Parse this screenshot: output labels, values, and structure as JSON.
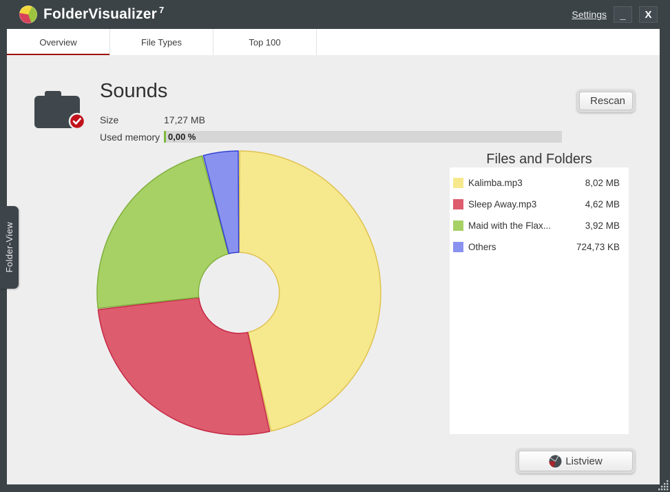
{
  "window": {
    "title": "FolderVisualizer",
    "version": "7",
    "settings_label": "Settings",
    "minimize_glyph": "_",
    "close_glyph": "X"
  },
  "tabs": [
    {
      "label": "Overview",
      "active": true
    },
    {
      "label": "File Types",
      "active": false
    },
    {
      "label": "Top 100",
      "active": false
    }
  ],
  "sidebar_tab": {
    "label": "Folder-View"
  },
  "overview": {
    "folder_name": "Sounds",
    "size_label": "Size",
    "size_value": "17,27 MB",
    "used_memory_label": "Used memory",
    "used_memory_value": "0,00 %",
    "used_memory_percent": 0,
    "rescan_label": "Rescan",
    "listview_label": "Listview"
  },
  "chart_data": {
    "type": "donut",
    "title": "Files and Folders",
    "unit": "MB",
    "total_value": 17.27,
    "start_angle_deg": 0,
    "direction": "clockwise",
    "inner_radius_ratio": 0.285,
    "legend_position": "right",
    "slices": [
      {
        "label": "Kalimba.mp3",
        "value": 8.02,
        "size_label": "8,02 MB",
        "color": "#F6E88D",
        "border_color": "#DFC14E"
      },
      {
        "label": "Sleep Away.mp3",
        "value": 4.62,
        "size_label": "4,62 MB",
        "color": "#DD5C6E",
        "border_color": "#C62846"
      },
      {
        "label": "Maid with the Flax...",
        "value": 3.92,
        "size_label": "3,92 MB",
        "color": "#A7D165",
        "border_color": "#7FAE3B"
      },
      {
        "label": "Others",
        "value": 0.71,
        "size_label": "724,73 KB",
        "color": "#8A92F0",
        "border_color": "#3240D2"
      }
    ]
  },
  "colors": {
    "frame_bg": "#3B4347",
    "content_bg": "#EEEEEE",
    "tab_accent_red": "#9B1005",
    "membar_bg": "#D6D6D6",
    "membar_fill": "#7DB93C",
    "badge_red": "#C1121C"
  }
}
